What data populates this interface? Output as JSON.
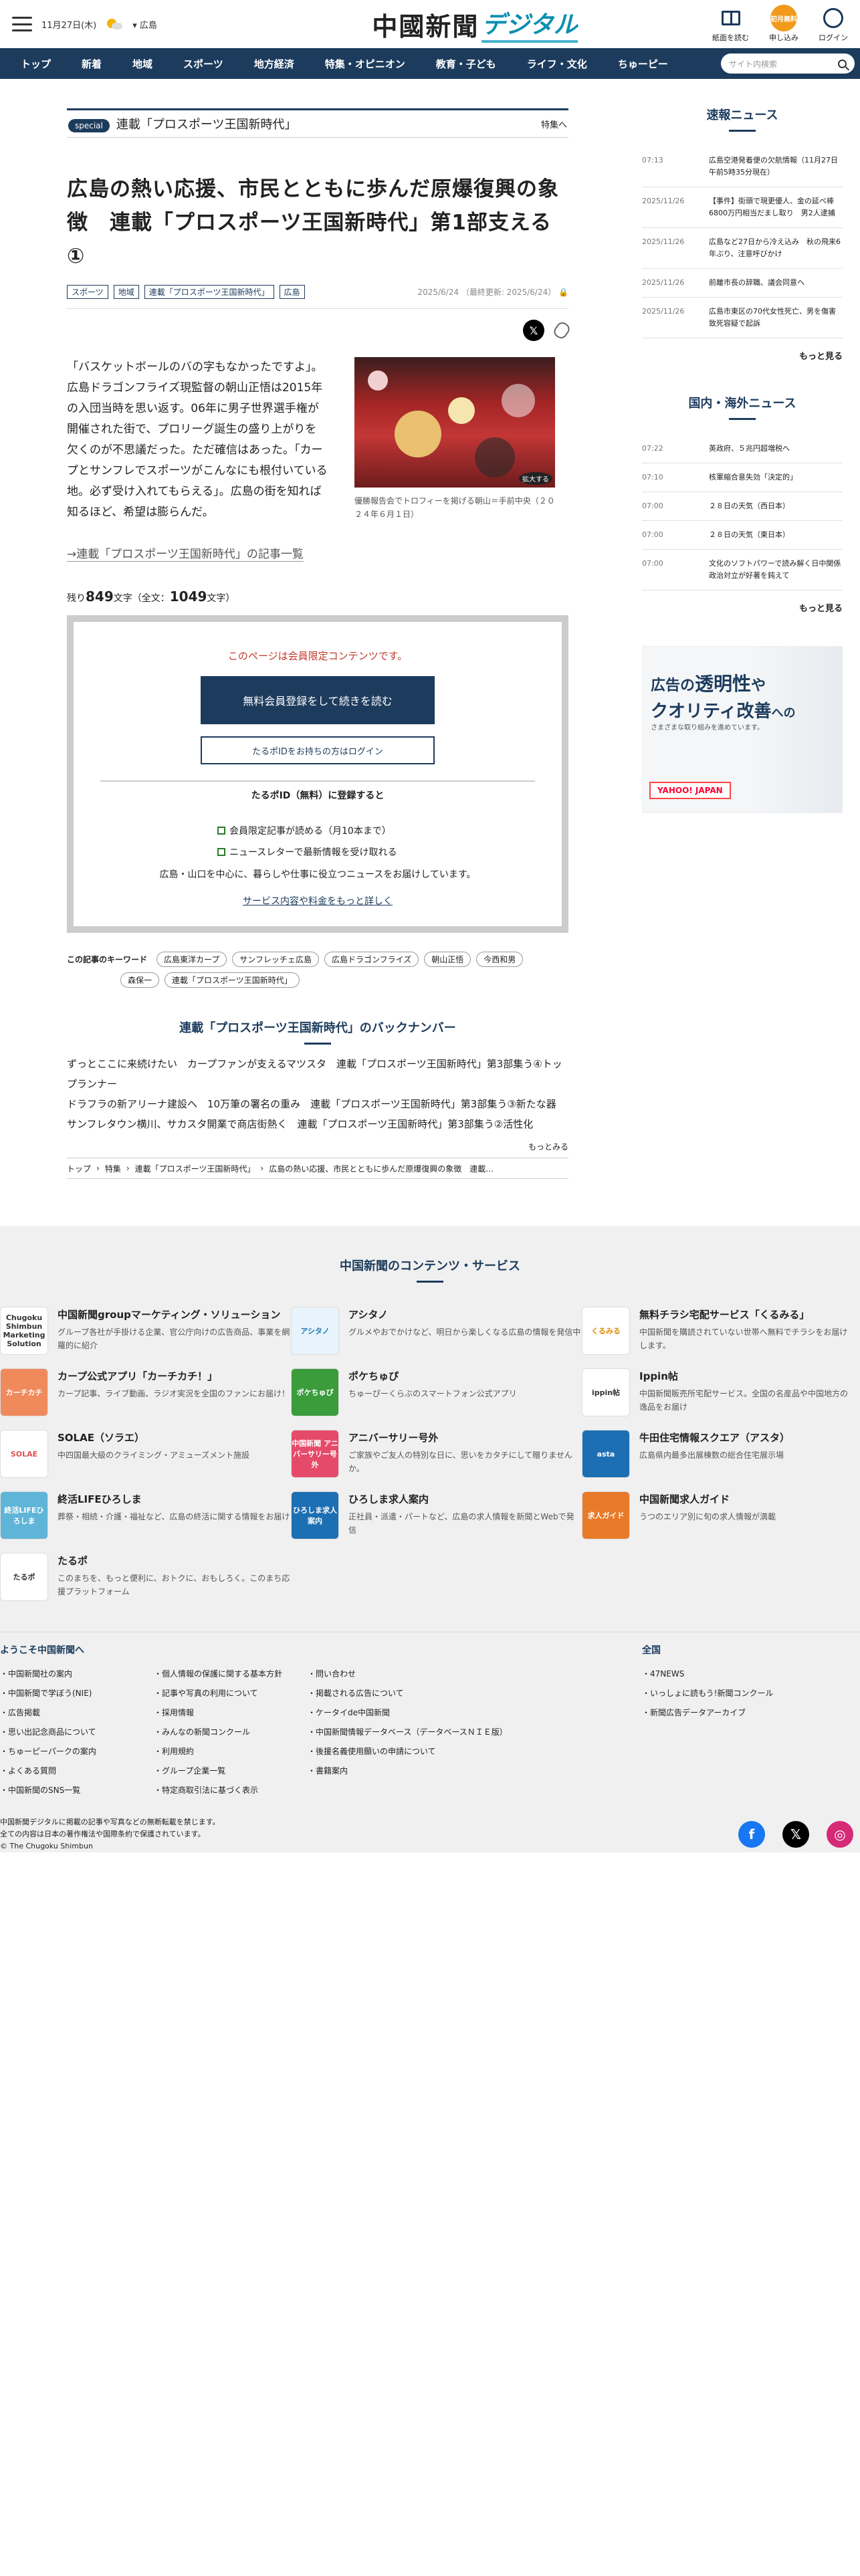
{
  "header": {
    "date": "11月27日(木)",
    "region": "広島",
    "logo_main": "中國新聞",
    "logo_sub": "デジタル",
    "icons": [
      {
        "label": "紙面を読む",
        "icon": "newspaper-icon"
      },
      {
        "label": "申し込み",
        "icon": "subscribe-icon",
        "badge": "初月無料"
      },
      {
        "label": "ログイン",
        "icon": "login-icon"
      }
    ]
  },
  "nav": {
    "items": [
      "トップ",
      "新着",
      "地域",
      "スポーツ",
      "地方経済",
      "特集・オピニオン",
      "教育・子ども",
      "ライフ・文化",
      "ちゅーピー"
    ],
    "search_placeholder": "サイト内検索"
  },
  "special": {
    "pill": "special",
    "title": "連載「プロスポーツ王国新時代」",
    "link": "特集へ"
  },
  "article": {
    "title": "広島の熱い応援、市民とともに歩んだ原爆復興の象徴　連載「プロスポーツ王国新時代」第1部支える①",
    "tags": [
      "スポーツ",
      "地域",
      "連載「プロスポーツ王国新時代」",
      "広島"
    ],
    "date": "2025/6/24",
    "updated": "（最終更新: 2025/6/24）",
    "body": "「バスケットボールのバの字もなかったですよ」。広島ドラゴンフライズ現監督の朝山正悟は2015年の入団当時を思い返す。06年に男子世界選手権が開催された街で、プロリーグ誕生の盛り上がりを欠くのが不思議だった。ただ確信はあった。「カープとサンフレでスポーツがこんなにも根付いている地。必ず受け入れてもらえる」。広島の街を知れば知るほど、希望は膨らんだ。",
    "caption": "優勝報告会でトロフィーを掲げる朝山＝手前中央（２０２４年６月１日）",
    "expand_label": "拡大する",
    "series_link": "→連載「プロスポーツ王国新時代」の記事一覧",
    "remaining_prefix": "残り",
    "remaining": "849",
    "remaining_mid": "文字（全文：",
    "total": "1049",
    "remaining_suffix": "文字）"
  },
  "paywall": {
    "note": "このページは会員限定コンテンツです。",
    "register_btn": "無料会員登録をして続きを読む",
    "login_btn": "たるポIDをお持ちの方はログイン",
    "heading": "たるポID（無料）に登録すると",
    "benefits": [
      "会員限定記事が読める（月10本まで）",
      "ニュースレターで最新情報を受け取れる"
    ],
    "desc": "広島・山口を中心に、暮らしや仕事に役立つニュースをお届けしています。",
    "link": "サービス内容や料金をもっと詳しく"
  },
  "keywords": {
    "label": "この記事のキーワード",
    "items": [
      "広島東洋カープ",
      "サンフレッチェ広島",
      "広島ドラゴンフライズ",
      "朝山正悟",
      "今西和男",
      "森保一",
      "連載「プロスポーツ王国新時代」"
    ]
  },
  "backnumber": {
    "title": "連載「プロスポーツ王国新時代」のバックナンバー",
    "items": [
      "ずっとここに来続けたい　カープファンが支えるマツスタ　連載「プロスポーツ王国新時代」第3部集う④トップランナー",
      "ドラフラの新アリーナ建設へ　10万筆の署名の重み　連載「プロスポーツ王国新時代」第3部集う③新たな器",
      "サンフレタウン横川、サカスタ開業で商店街熱く　連載「プロスポーツ王国新時代」第3部集う②活性化"
    ],
    "more": "もっとみる"
  },
  "breadcrumb": [
    "トップ",
    "特集",
    "連載「プロスポーツ王国新時代」",
    "広島の熱い応援、市民とともに歩んだ原爆復興の象徴　連載…"
  ],
  "sidebar": {
    "breaking_title": "速報ニュース",
    "breaking": [
      {
        "time": "07:13",
        "text": "広島空港発着便の欠航情報（11月27日午前5時35分現在）"
      },
      {
        "time": "2025/11/26",
        "text": "【事件】街頭で現更優人、金の延べ棒6800万円相当だまし取り　男2人逮捕"
      },
      {
        "time": "2025/11/26",
        "text": "広島など27日から冷え込み　秋の飛来6年ぶり、注意呼びかけ"
      },
      {
        "time": "2025/11/26",
        "text": "前離市長の辞職、議会同意へ"
      },
      {
        "time": "2025/11/26",
        "text": "広島市東区の70代女性死亡、男を傷害致死容疑で起訴"
      }
    ],
    "breaking_more": "もっと見る",
    "domestic_title": "国内・海外ニュース",
    "domestic": [
      {
        "time": "07:22",
        "text": "英政府、５兆円超増税へ"
      },
      {
        "time": "07:10",
        "text": "核軍縮合意失効「決定的」"
      },
      {
        "time": "07:00",
        "text": "２８日の天気（西日本）"
      },
      {
        "time": "07:00",
        "text": "２８日の天気（東日本）"
      },
      {
        "time": "07:00",
        "text": "文化のソフトパワーで読み解く日中関係 政治対立が好著を鈍えて"
      }
    ],
    "domestic_more": "もっと見る",
    "ad": {
      "line1a": "広告",
      "line1b": "の",
      "line1c": "透明性",
      "line1d": "や",
      "line2a": "クオリティ改善",
      "line2b": "への",
      "line3": "さまざまな取り組みを進めています。",
      "brand": "YAHOO! JAPAN"
    }
  },
  "services": {
    "title": "中国新聞のコンテンツ・サービス",
    "items": [
      {
        "name": "中国新聞groupマーケティング・ソリューション",
        "desc": "グループ各社が手掛ける企業、官公庁向けの広告商品、事業を網羅的に紹介",
        "icon_text": "Chugoku Shimbun Marketing Solution",
        "color": "#ffffff",
        "fg": "#333333"
      },
      {
        "name": "アシタノ",
        "desc": "グルメやおでかけなど、明日から楽しくなる広島の情報を発信中",
        "icon_text": "アシタノ",
        "color": "#e8f4fb",
        "fg": "#1d7ab0"
      },
      {
        "name": "無料チラシ宅配サービス「くるみる」",
        "desc": "中国新聞を購読されていない世帯へ無料でチラシをお届けします。",
        "icon_text": "くるみる",
        "color": "#ffffff",
        "fg": "#e08a00"
      },
      {
        "name": "カープ公式アプリ「カーチカチ！」",
        "desc": "カープ記事、ライブ動画、ラジオ実況を全国のファンにお届け！",
        "icon_text": "カーチカチ",
        "color": "#f08a5d",
        "fg": "#ffffff"
      },
      {
        "name": "ポケちゅぴ",
        "desc": "ちゅーぴーくらぶのスマートフォン公式アプリ",
        "icon_text": "ポケちゅぴ",
        "color": "#3a9c3a",
        "fg": "#ffffff"
      },
      {
        "name": "Ippin帖",
        "desc": "中国新聞販売所宅配サービス。全国の名産品や中国地方の逸品をお届け",
        "icon_text": "ippin帖",
        "color": "#ffffff",
        "fg": "#333333"
      },
      {
        "name": "SOLAE（ソラエ）",
        "desc": "中四国最大級のクライミング・アミューズメント施設",
        "icon_text": "SOLAE",
        "color": "#ffffff",
        "fg": "#e05050"
      },
      {
        "name": "アニバーサリー号外",
        "desc": "ご家族やご友人の特別な日に、思いをカタチにして贈りませんか。",
        "icon_text": "中国新聞 アニバーサリー号外",
        "color": "#e64a6a",
        "fg": "#ffffff"
      },
      {
        "name": "牛田住宅情報スクエア（アスタ）",
        "desc": "広島県内最多出展棟数の総合住宅展示場",
        "icon_text": "asta",
        "color": "#1d6fb3",
        "fg": "#ffffff"
      },
      {
        "name": "終活LIFEひろしま",
        "desc": "葬祭・相続・介護・福祉など、広島の終活に関する情報をお届け",
        "icon_text": "終活LIFEひろしま",
        "color": "#5fb5d8",
        "fg": "#ffffff"
      },
      {
        "name": "ひろしま求人案内",
        "desc": "正社員・派遣・パートなど、広島の求人情報を新聞とWebで発信",
        "icon_text": "ひろしま求人案内",
        "color": "#1d6fb3",
        "fg": "#ffffff"
      },
      {
        "name": "中国新聞求人ガイド",
        "desc": "うつのエリア別に旬の求人情報が満載",
        "icon_text": "求人ガイド",
        "color": "#e87a2a",
        "fg": "#ffffff"
      },
      {
        "name": "たるポ",
        "desc": "このまちを、もっと便利に、おトクに、おもしろく。このまち応援プラットフォーム",
        "icon_text": "たるポ",
        "color": "#ffffff",
        "fg": "#333333"
      }
    ]
  },
  "footer": {
    "welcome_title": "ようこそ中国新聞へ",
    "col1": [
      "中国新聞社の案内",
      "中国新聞で学ぼう(NIE)",
      "広告掲載",
      "思い出記念商品について",
      "ちゅーピーパークの案内",
      "よくある質問",
      "中国新聞のSNS一覧"
    ],
    "col2": [
      "個人情報の保護に関する基本方針",
      "記事や写真の利用について",
      "採用情報",
      "みんなの新聞コンクール",
      "利用規約",
      "グループ企業一覧",
      "特定商取引法に基づく表示"
    ],
    "col3": [
      "問い合わせ",
      "掲載される広告について",
      "ケータイde中国新聞",
      "中国新聞情報データベース（データベースＮＩＥ版）",
      "後援名義使用願いの申請について",
      "書籍案内"
    ],
    "national_title": "全国",
    "col4": [
      "47NEWS",
      "いっしょに読もう!新聞コンクール",
      "新聞広告データアーカイブ"
    ],
    "copyright1": "中国新聞デジタルに掲載の記事や写真などの無断転載を禁じます。",
    "copyright2": "全ての内容は日本の著作権法や国際条約で保護されています。",
    "copyright3": "© The Chugoku Shimbun",
    "sns": [
      {
        "icon": "facebook-icon",
        "glyph": "f",
        "color": "#1877f2"
      },
      {
        "icon": "x-icon",
        "glyph": "𝕏",
        "color": "#000000"
      },
      {
        "icon": "instagram-icon",
        "glyph": "◎",
        "color": "#d62976"
      }
    ]
  }
}
